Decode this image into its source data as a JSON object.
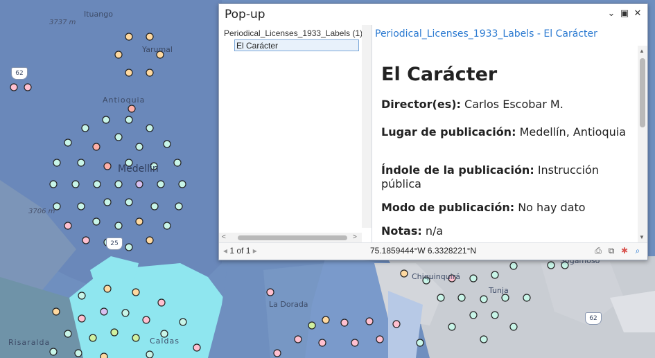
{
  "map": {
    "labels": {
      "ituango": "Ituango",
      "yarumal": "Yarumal",
      "antioquia": "Antioquia",
      "medellin": "Medellín",
      "la_dorada": "La Dorada",
      "chiquinquira": "Chiquinquirá",
      "tunja": "Tunja",
      "sogamoso": "Sogamoso",
      "risaralda": "Risaralda",
      "caldas": "Caldas",
      "elev_3737": "3737 m",
      "elev_3706": "3706 m"
    },
    "shields": {
      "r62_west": "62",
      "r25": "25",
      "r62_east": "62"
    },
    "colors": {
      "base_blue": "#6f8fbf",
      "cyan_region": "#8fe6ef",
      "gray_region": "#c9cdd3"
    }
  },
  "popup": {
    "title": "Pop-up",
    "buttons": {
      "collapse": "⌄",
      "maximize": "▣",
      "close": "✕"
    },
    "layer_node": "Periodical_Licenses_1933_Labels (1)",
    "feature_node": "El Carácter",
    "feature_header": "Periodical_Licenses_1933_Labels - El Carácter",
    "content_title": "El Carácter",
    "fields": {
      "director_label": "Director(es):",
      "director_value": "Carlos Escobar M.",
      "lugar_label": "Lugar de publicación:",
      "lugar_value": "Medellín, Antioquia",
      "indole_label": "Índole de la publicación:",
      "indole_value": "Instrucción pública",
      "modo_label": "Modo de publicación:",
      "modo_value": "No hay dato",
      "notas_label": "Notas:",
      "notas_value": "n/a"
    },
    "status": {
      "pager": "1 of 1",
      "coords": "75.1859444°W 6.3328221°N"
    }
  }
}
